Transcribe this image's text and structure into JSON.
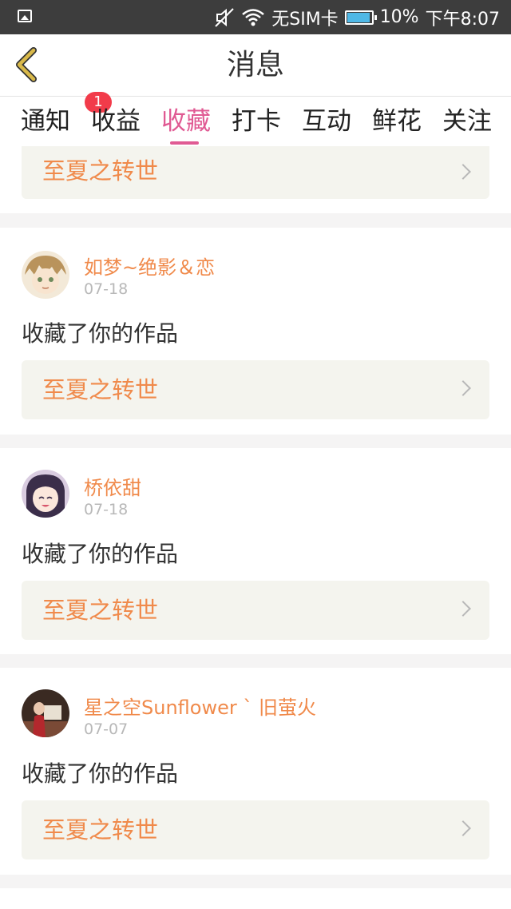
{
  "status_bar": {
    "no_sim": "无SIM卡",
    "battery": "10%",
    "time": "下午8:07",
    "icons": [
      "image-icon",
      "mute-icon",
      "wifi-icon",
      "battery-icon"
    ]
  },
  "header": {
    "title": "消息",
    "back_icon": "chevron-left-icon"
  },
  "tabs": [
    {
      "label": "通知",
      "badge": "1"
    },
    {
      "label": "收益"
    },
    {
      "label": "收藏",
      "active": true
    },
    {
      "label": "打卡"
    },
    {
      "label": "互动"
    },
    {
      "label": "鲜花"
    },
    {
      "label": "关注"
    }
  ],
  "partial_card": {
    "work_title": "至夏之转世"
  },
  "items": [
    {
      "username": "如梦~绝影＆恋",
      "date": "07-18",
      "action": "收藏了你的作品",
      "work_title": "至夏之转世"
    },
    {
      "username": "桥依甜",
      "date": "07-18",
      "action": "收藏了你的作品",
      "work_title": "至夏之转世"
    },
    {
      "username": "星之空Sunflower ˋ 旧萤火",
      "date": "07-07",
      "action": "收藏了你的作品",
      "work_title": "至夏之转世"
    }
  ],
  "colors": {
    "accent": "#e05a93",
    "work_title": "#f08a4b",
    "badge": "#f23b4a",
    "back_icon": "#d9b94a"
  }
}
